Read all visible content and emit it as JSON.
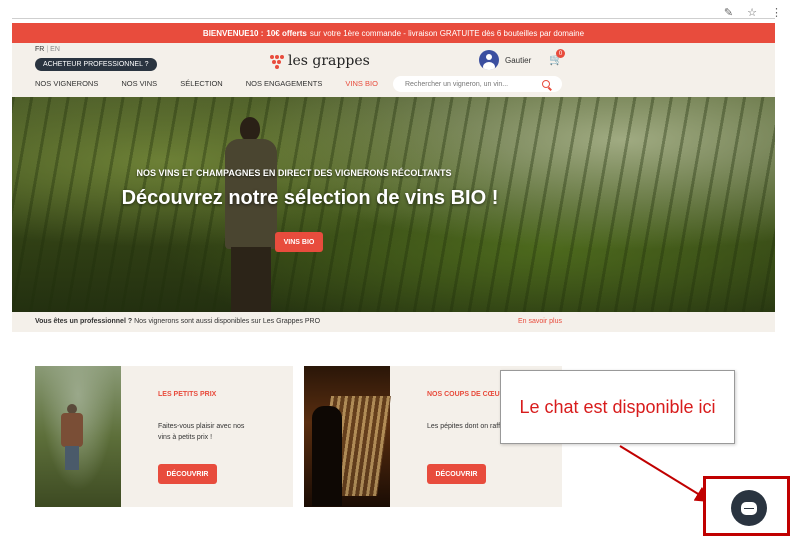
{
  "browser": {
    "icons": [
      "edit-icon",
      "star-icon",
      "more-icon"
    ],
    "edit_glyph": "✎",
    "star_glyph": "☆",
    "more_glyph": "⋮"
  },
  "promo": {
    "code": "BIENVENUE10 :",
    "offer": "10€ offerts",
    "text": "sur votre 1ère commande - livraison GRATUITE dès 6 bouteilles par domaine"
  },
  "header": {
    "lang_active": "FR",
    "lang_sep": "|",
    "lang_other": "EN",
    "pro_button": "ACHETEUR PROFESSIONNEL ?",
    "logo_text": "les grappes",
    "user_name": "Gautier",
    "cart_count": "0",
    "cart_glyph": "🛒",
    "search_placeholder": "Rechercher un vigneron, un vin..."
  },
  "nav": [
    {
      "label": "NOS VIGNERONS"
    },
    {
      "label": "NOS VINS"
    },
    {
      "label": "SÉLECTION"
    },
    {
      "label": "NOS ENGAGEMENTS"
    },
    {
      "label": "VINS BIO"
    }
  ],
  "hero": {
    "subtitle": "NOS VINS ET CHAMPAGNES EN DIRECT DES VIGNERONS RÉCOLTANTS",
    "title": "Découvrez notre sélection de vins BIO !",
    "button": "VINS BIO"
  },
  "pro_bar": {
    "bold": "Vous êtes un professionnel ?",
    "text": "Nos vignerons sont aussi disponibles sur Les Grappes PRO",
    "link": "En savoir plus"
  },
  "cards": [
    {
      "title": "LES PETITS PRIX",
      "text": "Faites-vous plaisir avec nos vins à petits prix !",
      "button": "DÉCOUVRIR"
    },
    {
      "title": "NOS COUPS DE CŒUR",
      "text": "Les pépites dont on raffole !",
      "button": "DÉCOUVRIR"
    }
  ],
  "annotation": {
    "callout_text": "Le chat est disponible ici",
    "accent_color": "#c00000"
  },
  "colors": {
    "brand_red": "#e84c3d",
    "dark": "#2a3440",
    "cream": "#f4f0ea"
  }
}
